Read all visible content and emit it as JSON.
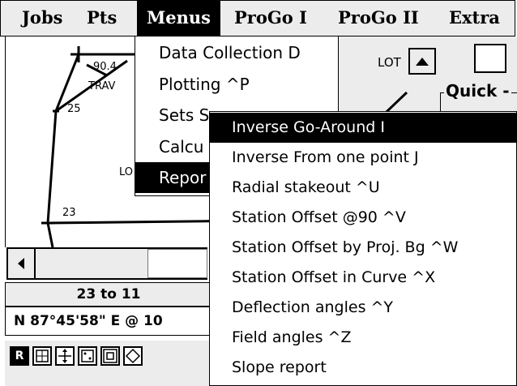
{
  "menubar": {
    "items": [
      "Jobs",
      "Pts",
      "Menus",
      "ProGo I",
      "ProGo II",
      "Extra"
    ],
    "active": "Menus"
  },
  "map": {
    "labels": {
      "p1": "90.4",
      "trav": "TRAV",
      "p25": "25",
      "p23": "23",
      "lo": "LO",
      "lot": "LOT"
    }
  },
  "panel": {
    "quick_label": "Quick -"
  },
  "status": {
    "range": "23 to 11",
    "bearing": "N  87°45'58\" E @ 10"
  },
  "toolbar": {
    "buttons": [
      "R",
      "grid-icon",
      "move-icon",
      "zoom-extents-icon",
      "zoom-window-icon",
      "diamond-icon"
    ]
  },
  "menus_dropdown": {
    "items": [
      "Data Collection D",
      "Plotting ^P",
      "Sets S",
      "Calcu",
      "Repor"
    ],
    "selected_index": 4
  },
  "reports_submenu": {
    "items": [
      "Inverse Go-Around I",
      "Inverse From one point J",
      "Radial stakeout ^U",
      "Station Offset @90 ^V",
      "Station Offset by Proj. Bg ^W",
      "Station Offset in Curve ^X",
      "Deflection angles ^Y",
      "Field angles ^Z",
      "Slope report"
    ],
    "selected_index": 0
  }
}
